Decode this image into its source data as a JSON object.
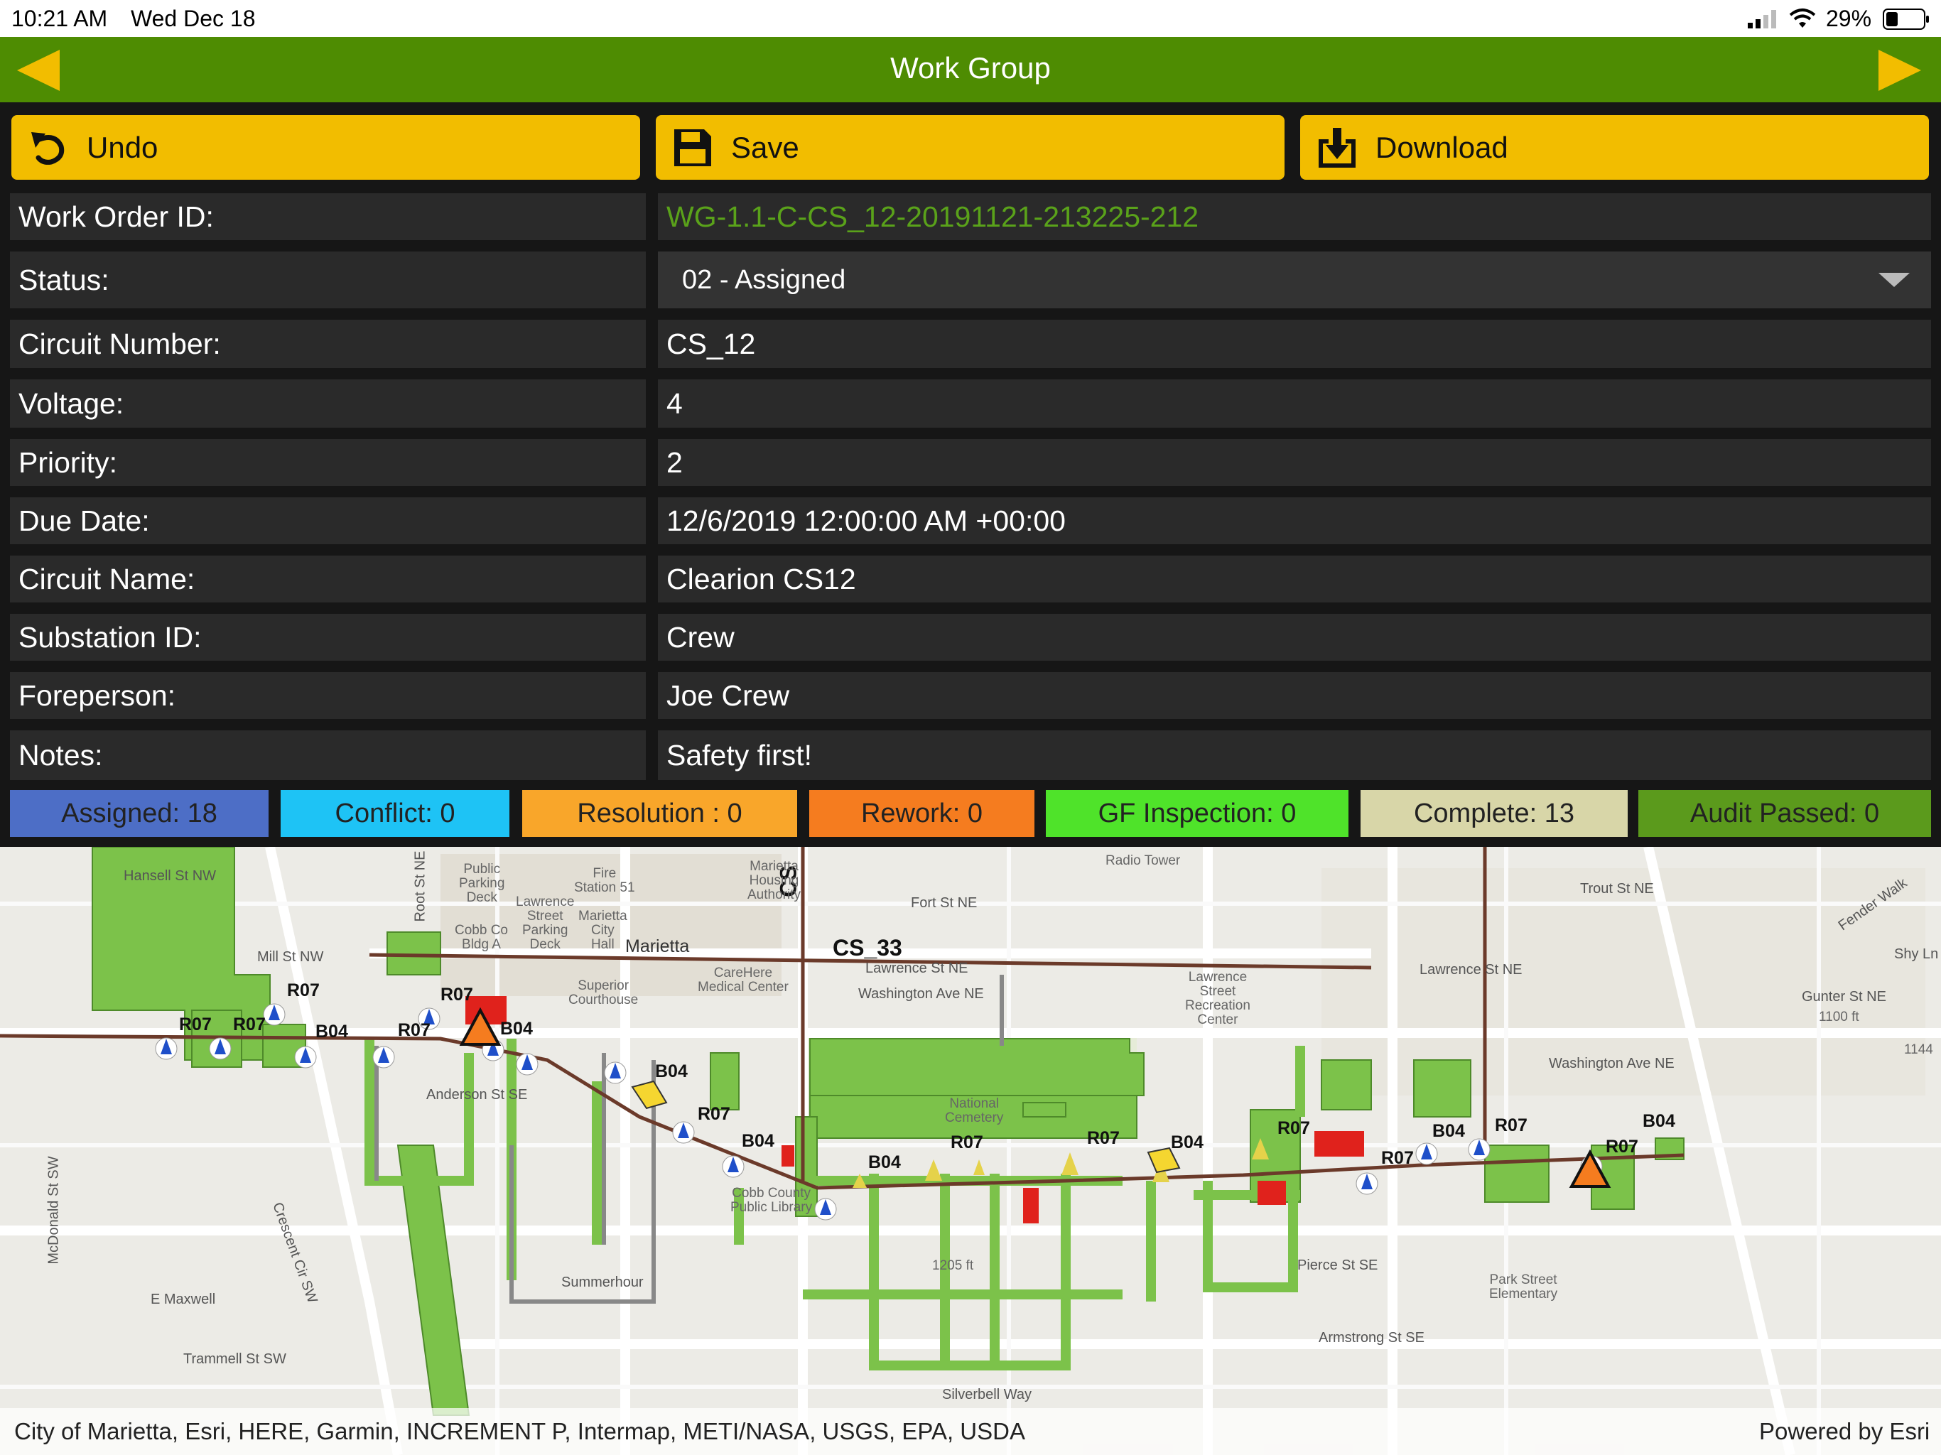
{
  "statusbar": {
    "time": "10:21 AM",
    "date": "Wed Dec 18",
    "battery_pct": "29%",
    "signal_icon": "cell-signal-icon",
    "wifi_icon": "wifi-icon",
    "battery_icon": "battery-icon"
  },
  "header": {
    "title": "Work Group",
    "prev_icon": "triangle-left-icon",
    "next_icon": "triangle-right-icon",
    "color": "#4e8c02"
  },
  "toolbar": {
    "undo_label": "Undo",
    "save_label": "Save",
    "download_label": "Download",
    "button_color": "#f2bd00"
  },
  "form": {
    "work_order_id_label": "Work Order ID:",
    "work_order_id": "WG-1.1-C-CS_12-20191121-213225-212",
    "status_label": "Status:",
    "status": "02 - Assigned",
    "circuit_number_label": "Circuit Number:",
    "circuit_number": "CS_12",
    "voltage_label": "Voltage:",
    "voltage": "4",
    "priority_label": "Priority:",
    "priority": "2",
    "due_date_label": "Due Date:",
    "due_date": "12/6/2019 12:00:00 AM +00:00",
    "circuit_name_label": "Circuit Name:",
    "circuit_name": "Clearion CS12",
    "substation_id_label": "Substation ID:",
    "substation_id": "Crew",
    "foreperson_label": "Foreperson:",
    "foreperson": "Joe Crew",
    "notes_label": "Notes:",
    "notes": "Safety first!"
  },
  "counts": [
    {
      "label": "Assigned: 18",
      "color": "#4d6ec6"
    },
    {
      "label": "Conflict: 0",
      "color": "#1ec3f5"
    },
    {
      "label": "Resolution : 0",
      "color": "#f9a62a"
    },
    {
      "label": "Rework: 0",
      "color": "#f57c1f"
    },
    {
      "label": "GF Inspection: 0",
      "color": "#4fe32a"
    },
    {
      "label": "Complete: 13",
      "color": "#d8d6a8"
    },
    {
      "label": "Audit Passed: 0",
      "color": "#5b9a1c"
    }
  ],
  "map": {
    "circuit_labels": [
      "CS_33",
      "CS"
    ],
    "work_codes": [
      "R07",
      "R07",
      "R07",
      "B04",
      "R07",
      "R07",
      "B04",
      "B04",
      "R07",
      "B04",
      "B04",
      "R07",
      "R07",
      "B04",
      "R07",
      "R07",
      "B04",
      "R07",
      "B04",
      "R07"
    ],
    "streets": {
      "hansell": "Hansell St NW",
      "mill": "Mill St NW",
      "root": "Root St NE",
      "fort": "Fort St NE",
      "washington": "Washington Ave NE",
      "washington2": "Washington Ave NE",
      "lawrence": "Lawrence St NE",
      "lawrence2": "Lawrence St NE",
      "trout": "Trout St NE",
      "gunter": "Gunter St NE",
      "pierce": "Pierce St SE",
      "armstrong": "Armstrong St SE",
      "maxwell": "E Maxwell",
      "trammell": "Trammell St SW",
      "mcdonald": "McDonald St SW",
      "anderson": "Anderson St SE",
      "summerhour": "Summerhour",
      "silverbell": "Silverbell Way",
      "fender": "Fender Walk",
      "shy": "Shy Ln",
      "crescent": "Crescent Cir SW"
    },
    "pois": {
      "marietta": "Marietta",
      "fire_station": "Fire\nStation 51",
      "public_parking": "Public\nParking\nDeck",
      "lawrence_deck": "Lawrence\nStreet\nParking\nDeck",
      "city_hall": "Marietta\nCity\nHall",
      "cobb_bldg": "Cobb Co\nBldg A",
      "courthouse": "Superior\nCourthouse",
      "carehere": "CareHere\nMedical Center",
      "national_cemetery": "National\nCemetery",
      "rec_center": "Lawrence\nStreet\nRecreation\nCenter",
      "park_street": "Park Street\nElementary",
      "cobb_library": "Cobb County\nPublic Library",
      "radio_tower": "Radio Tower",
      "marietta_housing": "Marietta\nHousing\nAuthority",
      "elevation1": "1205 ft",
      "elevation2": "1100 ft",
      "elevation3": "1144"
    },
    "attribution": "City of Marietta, Esri, HERE, Garmin, INCREMENT P, Intermap, METI/NASA, USGS, EPA, USDA",
    "powered_by": "Powered by Esri",
    "line_color": "#6b3a2a",
    "parcel_color": "#7cc24a"
  }
}
